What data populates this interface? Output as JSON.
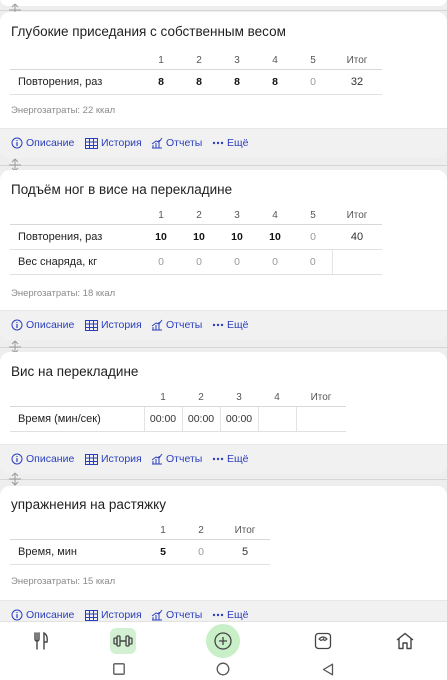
{
  "colors": {
    "accent": "#2a3fbf",
    "active_nav": "#d3f0d3",
    "add_button": "#c9efc9"
  },
  "actions": {
    "description": "Описание",
    "history": "История",
    "reports": "Отчеты",
    "more": "Ещё"
  },
  "exercises": [
    {
      "title": "Глубокие приседания с собственным весом",
      "columns": [
        "1",
        "2",
        "3",
        "4",
        "5",
        "Итог"
      ],
      "rows": [
        {
          "label": "Повторения, раз",
          "values": [
            "8",
            "8",
            "8",
            "8",
            "0"
          ],
          "total": "32"
        }
      ],
      "energy": "Энергозатраты: 22 ккал"
    },
    {
      "title": "Подъём ног в висе на перекладине",
      "columns": [
        "1",
        "2",
        "3",
        "4",
        "5",
        "Итог"
      ],
      "rows": [
        {
          "label": "Повторения, раз",
          "values": [
            "10",
            "10",
            "10",
            "10",
            "0"
          ],
          "total": "40"
        },
        {
          "label": "Вес снаряда, кг",
          "values": [
            "0",
            "0",
            "0",
            "0",
            "0"
          ],
          "total": ""
        }
      ],
      "energy": "Энергозатраты: 18 ккал"
    },
    {
      "title": "Вис на перекладине",
      "columns": [
        "1",
        "2",
        "3",
        "4",
        "Итог"
      ],
      "rows": [
        {
          "label": "Время (мин/сек)",
          "values": [
            "00:00",
            "00:00",
            "00:00",
            ""
          ],
          "total": ""
        }
      ],
      "energy": ""
    },
    {
      "title": "упражнения на растяжку",
      "columns": [
        "1",
        "2",
        "Итог"
      ],
      "rows": [
        {
          "label": "Время, мин",
          "values": [
            "5",
            "0"
          ],
          "total": "5"
        }
      ],
      "energy": "Энергозатраты: 15 ккал"
    }
  ],
  "bottom_nav": {
    "items": [
      "nutrition-icon",
      "workout-icon",
      "add-icon",
      "scale-icon",
      "home-icon"
    ],
    "active": "workout-icon"
  },
  "system_nav": [
    "recents-square",
    "home-circle",
    "back-triangle"
  ]
}
